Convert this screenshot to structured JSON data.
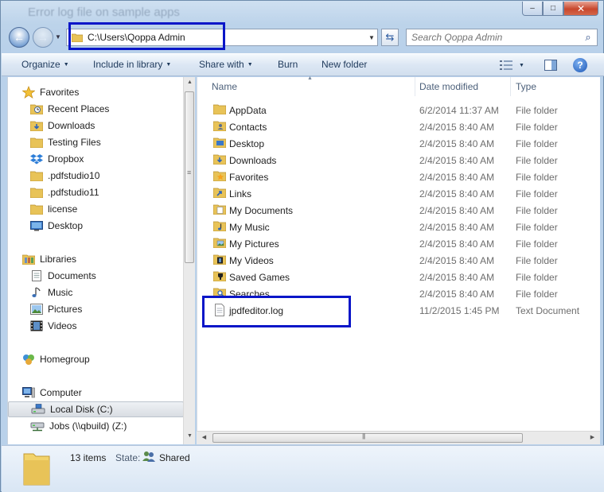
{
  "window": {
    "title_ghost": "Error log file on sample apps",
    "controls": {
      "minimize": "–",
      "maximize": "□",
      "close": "✕"
    }
  },
  "nav": {
    "back_icon": "back-arrow-icon",
    "forward_icon": "forward-arrow-icon",
    "address": "C:\\Users\\Qoppa Admin",
    "search_placeholder": "Search Qoppa Admin"
  },
  "toolbar": {
    "organize": "Organize",
    "include_in_library": "Include in library",
    "share_with": "Share with",
    "burn": "Burn",
    "new_folder": "New folder"
  },
  "sidebar": {
    "favorites": {
      "label": "Favorites",
      "items": [
        {
          "label": "Recent Places",
          "icon": "recent-places-icon"
        },
        {
          "label": "Downloads",
          "icon": "downloads-folder-icon"
        },
        {
          "label": "Testing Files",
          "icon": "folder-icon"
        },
        {
          "label": "Dropbox",
          "icon": "dropbox-icon"
        },
        {
          "label": ".pdfstudio10",
          "icon": "folder-icon"
        },
        {
          "label": ".pdfstudio11",
          "icon": "folder-icon"
        },
        {
          "label": "license",
          "icon": "folder-icon"
        },
        {
          "label": "Desktop",
          "icon": "desktop-icon"
        }
      ]
    },
    "libraries": {
      "label": "Libraries",
      "items": [
        {
          "label": "Documents",
          "icon": "documents-icon"
        },
        {
          "label": "Music",
          "icon": "music-icon"
        },
        {
          "label": "Pictures",
          "icon": "pictures-icon"
        },
        {
          "label": "Videos",
          "icon": "videos-icon"
        }
      ]
    },
    "homegroup": {
      "label": "Homegroup"
    },
    "computer": {
      "label": "Computer",
      "items": [
        {
          "label": "Local Disk (C:)",
          "icon": "local-disk-icon",
          "selected": true
        },
        {
          "label": "Jobs (\\\\qbuild) (Z:)",
          "icon": "network-drive-icon"
        }
      ]
    }
  },
  "columns": {
    "name": "Name",
    "date": "Date modified",
    "type": "Type"
  },
  "files": [
    {
      "name": "AppData",
      "date": "6/2/2014 11:37 AM",
      "type": "File folder",
      "icon": "folder-icon"
    },
    {
      "name": "Contacts",
      "date": "2/4/2015 8:40 AM",
      "type": "File folder",
      "icon": "contacts-folder-icon"
    },
    {
      "name": "Desktop",
      "date": "2/4/2015 8:40 AM",
      "type": "File folder",
      "icon": "desktop-folder-icon"
    },
    {
      "name": "Downloads",
      "date": "2/4/2015 8:40 AM",
      "type": "File folder",
      "icon": "downloads-folder-icon"
    },
    {
      "name": "Favorites",
      "date": "2/4/2015 8:40 AM",
      "type": "File folder",
      "icon": "favorites-folder-icon"
    },
    {
      "name": "Links",
      "date": "2/4/2015 8:40 AM",
      "type": "File folder",
      "icon": "links-folder-icon"
    },
    {
      "name": "My Documents",
      "date": "2/4/2015 8:40 AM",
      "type": "File folder",
      "icon": "documents-folder-icon"
    },
    {
      "name": "My Music",
      "date": "2/4/2015 8:40 AM",
      "type": "File folder",
      "icon": "music-folder-icon"
    },
    {
      "name": "My Pictures",
      "date": "2/4/2015 8:40 AM",
      "type": "File folder",
      "icon": "pictures-folder-icon"
    },
    {
      "name": "My Videos",
      "date": "2/4/2015 8:40 AM",
      "type": "File folder",
      "icon": "videos-folder-icon"
    },
    {
      "name": "Saved Games",
      "date": "2/4/2015 8:40 AM",
      "type": "File folder",
      "icon": "saved-games-folder-icon"
    },
    {
      "name": "Searches",
      "date": "2/4/2015 8:40 AM",
      "type": "File folder",
      "icon": "searches-folder-icon"
    },
    {
      "name": "jpdfeditor.log",
      "date": "11/2/2015 1:45 PM",
      "type": "Text Document",
      "icon": "text-document-icon"
    }
  ],
  "details": {
    "item_count": "13 items",
    "state_label": "State:",
    "state_value": "Shared"
  },
  "colors": {
    "highlight_box": "#0a16c8",
    "folder_yellow": "#e8c358",
    "toolbar_text": "#1e395b"
  }
}
